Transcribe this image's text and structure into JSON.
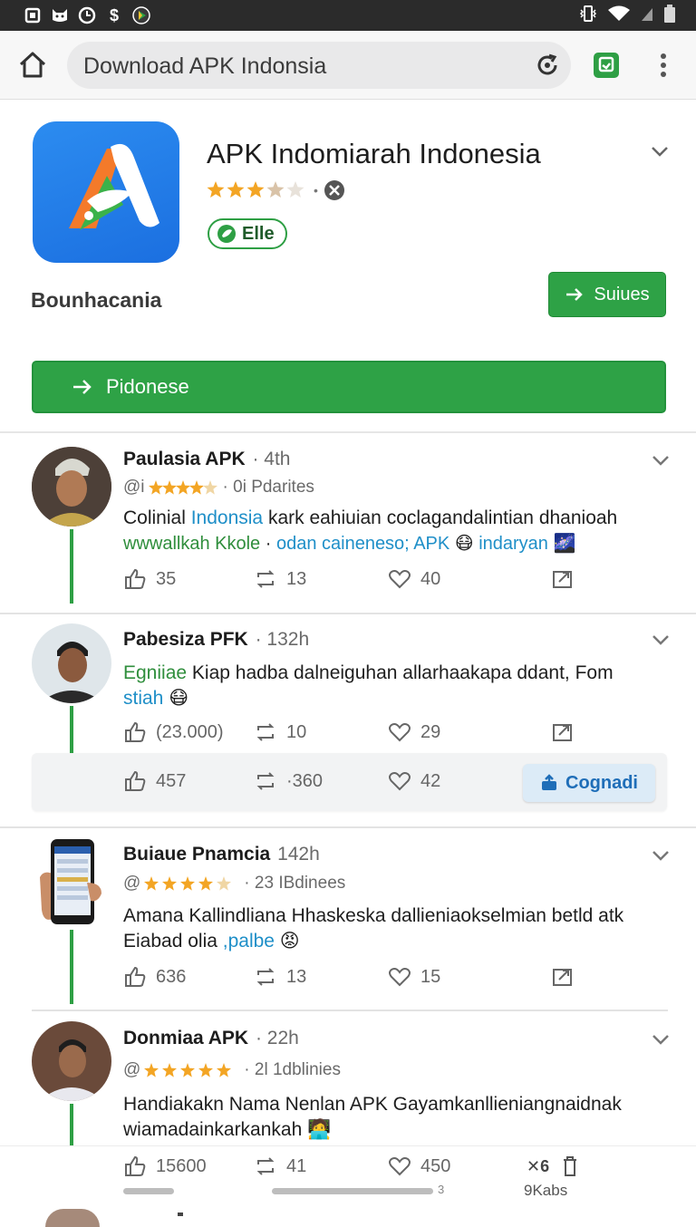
{
  "status_bar": {
    "left_icons": [
      "sim-icon",
      "cat-icon",
      "clock-icon",
      "dollar-icon",
      "play-icon"
    ],
    "right_icons": [
      "vibrate-icon",
      "wifi-icon",
      "signal-icon",
      "battery-icon"
    ],
    "dollar": "$"
  },
  "browser": {
    "url_text": "Download APK Indonsia"
  },
  "app": {
    "title": "APK Indomiarah Indonesia",
    "rating_stars": 3,
    "badge_label": "Elle",
    "developer": "Bounhacania",
    "small_button_label": "Suiues",
    "wide_button_label": "Pidonese",
    "brand_green": "#2ea246"
  },
  "posts": [
    {
      "name": "Paulasia APK",
      "time": "· 4th",
      "rating_prefix": "@i",
      "rating_text": "· 0i Pdarites",
      "text_parts": [
        {
          "t": "Colinial ",
          "c": ""
        },
        {
          "t": "Indonsia",
          "c": "blue"
        },
        {
          "t": " kark eahiuian coclagandalintian dhanioah",
          "c": ""
        }
      ],
      "text_line2": [
        {
          "t": "wwwallkah Kkole",
          "c": "green"
        },
        {
          "t": " · ",
          "c": ""
        },
        {
          "t": "odan caineneso; APK",
          "c": "blue"
        },
        {
          "t": " 😷 ",
          "c": ""
        },
        {
          "t": "indaryan",
          "c": "blue"
        },
        {
          "t": " 🌌",
          "c": ""
        }
      ],
      "likes": "35",
      "reposts": "13",
      "hearts": "40"
    },
    {
      "name": "Pabesiza PFK",
      "time": "· 132h",
      "text_parts": [
        {
          "t": "Egniiae",
          "c": "green"
        },
        {
          "t": " Kiap hadba dalneiguhan allarhaakapa ddant, Fom",
          "c": ""
        }
      ],
      "text_line2": [
        {
          "t": "stiah",
          "c": "blue"
        },
        {
          "t": " 😷",
          "c": ""
        }
      ],
      "likes": "(23.000)",
      "reposts": "10",
      "hearts": "29",
      "sub_actions": {
        "likes": "457",
        "reposts": "·360",
        "hearts": "42",
        "button_label": "Cognadi"
      }
    },
    {
      "name": "Buiaue Pnamcia",
      "time": "142h",
      "rating_prefix": "@",
      "rating_text": "· 23 IBdinees",
      "text_parts": [
        {
          "t": "Amana Kallindliana Hhaskeska dallieniaokselmian betld atk",
          "c": ""
        }
      ],
      "text_line2": [
        {
          "t": "Eiabad olia ",
          "c": ""
        },
        {
          "t": ",palbe",
          "c": "blue"
        },
        {
          "t": " 😡",
          "c": ""
        }
      ],
      "likes": "636",
      "reposts": "13",
      "hearts": "15"
    },
    {
      "name": "Donmiaa APK",
      "time": "· 22h",
      "rating_prefix": "@",
      "rating_text": "· 2l 1dblinies",
      "text_parts": [
        {
          "t": "Handiakakn Nama Nenlan APK Gayamkanllieniangnaidnak",
          "c": ""
        }
      ],
      "text_line2": [
        {
          "t": "wiamadainkarkankah",
          "c": ""
        },
        {
          "t": " 🧑‍💻",
          "c": ""
        }
      ]
    }
  ],
  "bottom_actions": {
    "likes": "15600",
    "reposts": "41",
    "hearts": "450",
    "close_glyph": "✕6",
    "scroll_page": "3",
    "tabs_label": "9Kabs"
  }
}
